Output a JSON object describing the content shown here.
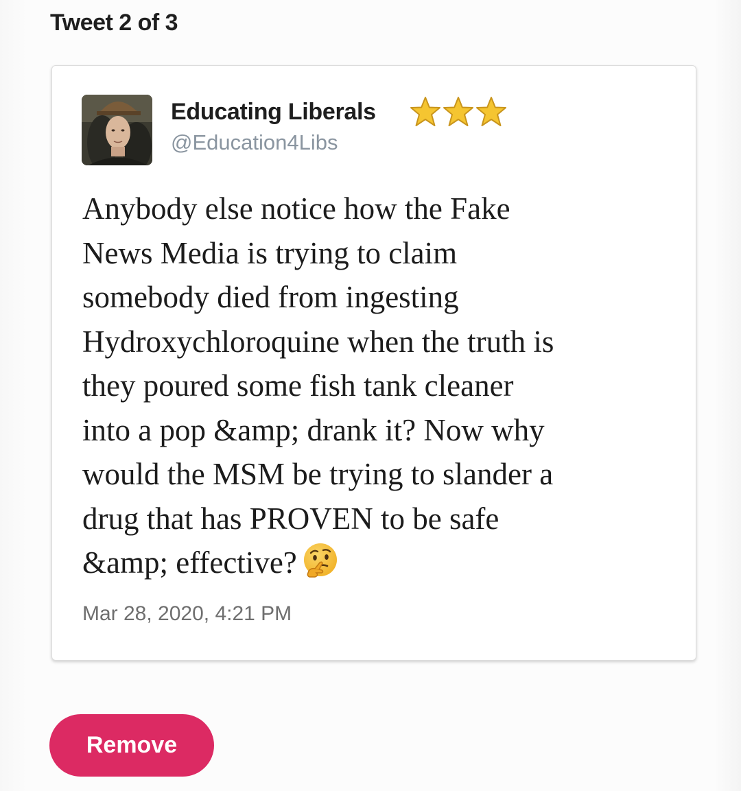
{
  "header": {
    "tweet_counter": "Tweet 2 of 3"
  },
  "tweet": {
    "display_name": "Educating Liberals",
    "name_badges": [
      "star-icon",
      "star-icon",
      "star-icon"
    ],
    "handle": "@Education4Libs",
    "text": "Anybody else notice how the Fake\nNews Media is trying to claim\nsomebody died from ingesting\nHydroxychloroquine when the truth is\nthey poured some fish tank cleaner\ninto a pop &amp; drank it? Now why\nwould the MSM be trying to slander a\ndrug that has PROVEN to be safe\n&amp; effective?",
    "trailing_emoji": "thinking-face-emoji",
    "timestamp": "Mar 28, 2020, 4:21 PM"
  },
  "actions": {
    "remove_label": "Remove"
  },
  "colors": {
    "remove_button": "#dc2a63",
    "star_fill": "#f5c531",
    "handle_text": "#8a95a0"
  }
}
